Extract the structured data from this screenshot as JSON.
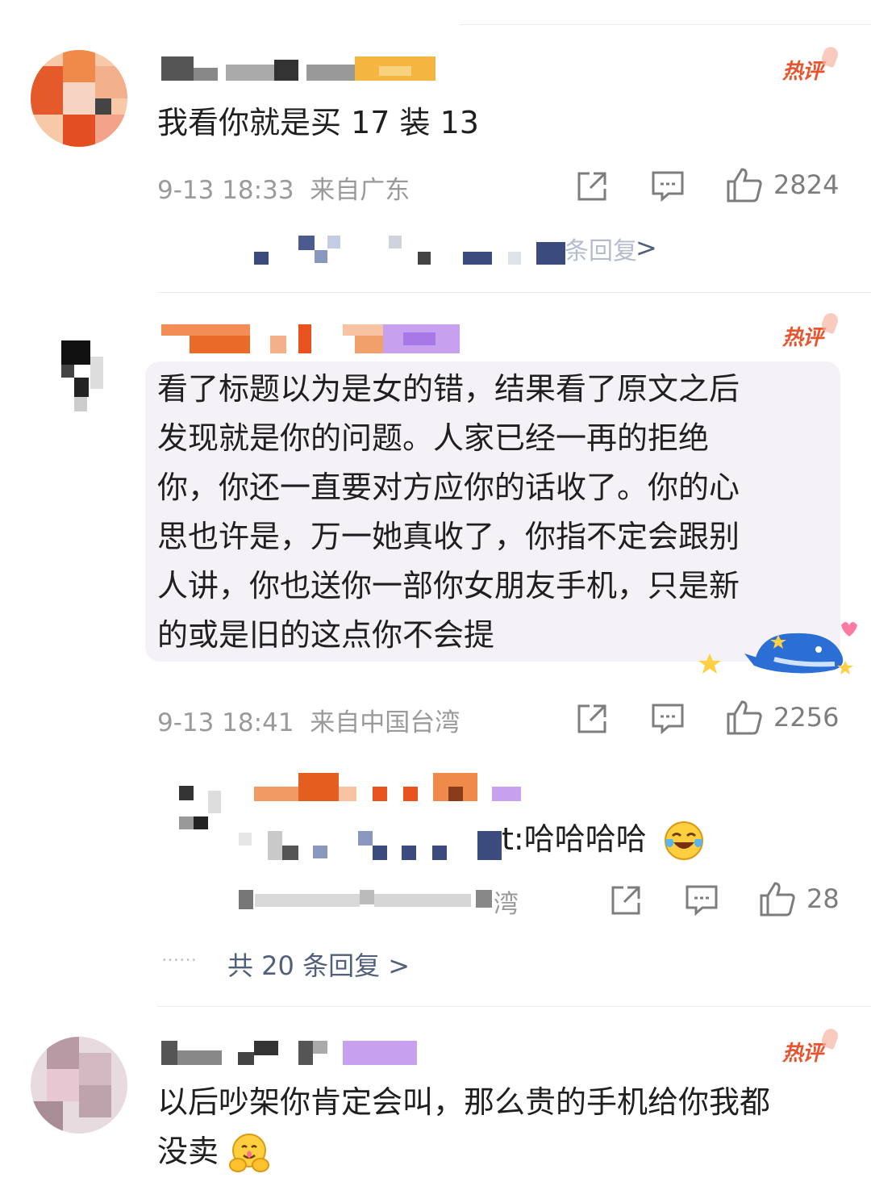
{
  "comments": [
    {
      "text": "我看你就是买 17 装 13",
      "date": "9-13 18:33",
      "location": "来自广东",
      "likes": "2824",
      "badge": "热评",
      "more_replies": "条回复 >"
    },
    {
      "text_lines": [
        "看了标题以为是女的错，结果看了原文之后",
        "发现就是你的问题。人家已经一再的拒绝",
        "你，你还一直要对方应你的话收了。你的心",
        "思也许是，万一她真收了，你指不定会跟别",
        "人讲，你也送你一部你女朋友手机，只是新",
        "的或是旧的这点你不会提"
      ],
      "date": "9-13 18:41",
      "location": "来自中国台湾",
      "likes": "2256",
      "badge": "热评",
      "reply": {
        "text": "t:哈哈哈哈",
        "location_partial": "湾",
        "likes": "28"
      },
      "total_replies": "共 20 条回复 >",
      "dots": "……"
    },
    {
      "text_lines": [
        "以后吵架你肯定会叫，那么贵的手机给你我都",
        "没卖"
      ],
      "badge": "热评"
    }
  ],
  "icons": {
    "share": "share-icon",
    "comment": "comment-icon",
    "like": "like-icon",
    "emoji_laugh": "laughing-crying-emoji",
    "emoji_hug": "hugging-emoji",
    "whale": "whale-sticker"
  },
  "colors": {
    "hot_badge": "#e8542e",
    "link": "#51607a",
    "meta": "#9a9a9a",
    "bubble": "#f4f1f7"
  }
}
